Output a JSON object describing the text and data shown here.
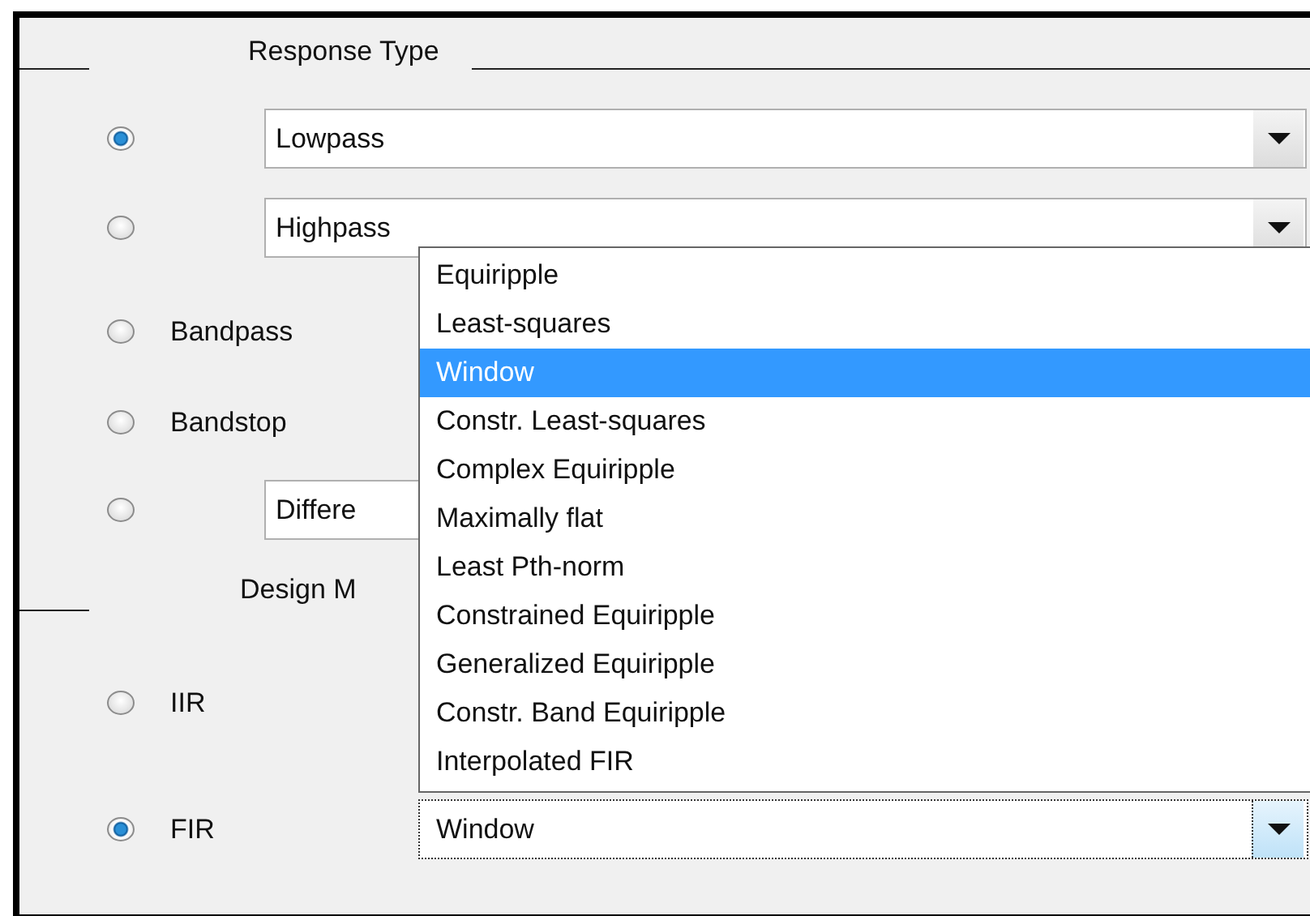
{
  "response_type": {
    "title": "Response Type",
    "options": [
      {
        "kind": "dropdown",
        "selected": true,
        "value": "Lowpass"
      },
      {
        "kind": "dropdown",
        "selected": false,
        "value": "Highpass"
      },
      {
        "kind": "label",
        "selected": false,
        "label": "Bandpass"
      },
      {
        "kind": "label",
        "selected": false,
        "label": "Bandstop"
      },
      {
        "kind": "covered_dropdown",
        "selected": false,
        "value": "Differe"
      }
    ]
  },
  "design_method": {
    "title": "Design M",
    "options": [
      {
        "kind": "label",
        "selected": false,
        "label": "IIR"
      },
      {
        "kind": "labeled_dropdown",
        "selected": true,
        "label": "FIR",
        "value": "Window"
      }
    ]
  },
  "popup_list": {
    "items": [
      {
        "label": "Equiripple",
        "selected": false
      },
      {
        "label": "Least-squares",
        "selected": false
      },
      {
        "label": "Window",
        "selected": true
      },
      {
        "label": "Constr. Least-squares",
        "selected": false
      },
      {
        "label": "Complex Equiripple",
        "selected": false
      },
      {
        "label": "Maximally flat",
        "selected": false
      },
      {
        "label": "Least Pth-norm",
        "selected": false
      },
      {
        "label": "Constrained Equiripple",
        "selected": false
      },
      {
        "label": "Generalized Equiripple",
        "selected": false
      },
      {
        "label": "Constr. Band Equiripple",
        "selected": false
      },
      {
        "label": "Interpolated FIR",
        "selected": false
      }
    ]
  }
}
